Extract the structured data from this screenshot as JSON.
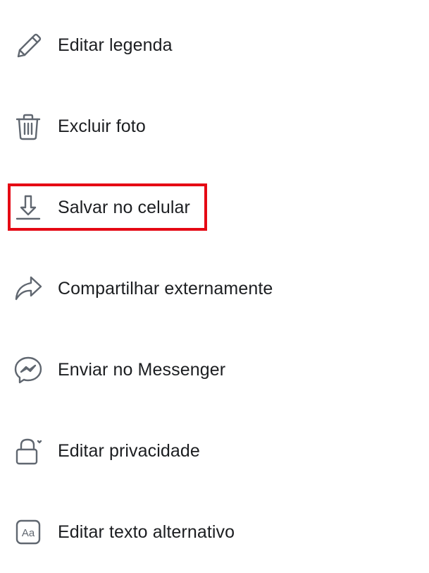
{
  "menu": {
    "items": [
      {
        "label": "Editar legenda",
        "icon": "pencil-icon"
      },
      {
        "label": "Excluir foto",
        "icon": "trash-icon"
      },
      {
        "label": "Salvar no celular",
        "icon": "download-icon"
      },
      {
        "label": "Compartilhar externamente",
        "icon": "share-arrow-icon"
      },
      {
        "label": "Enviar no Messenger",
        "icon": "messenger-icon"
      },
      {
        "label": "Editar privacidade",
        "icon": "lock-icon"
      },
      {
        "label": "Editar texto alternativo",
        "icon": "alt-text-icon"
      }
    ],
    "highlighted_item": "Salvar no celular"
  },
  "colors": {
    "text": "#1c1e21",
    "icon": "#606770",
    "highlight": "#e50914",
    "background": "#ffffff"
  }
}
